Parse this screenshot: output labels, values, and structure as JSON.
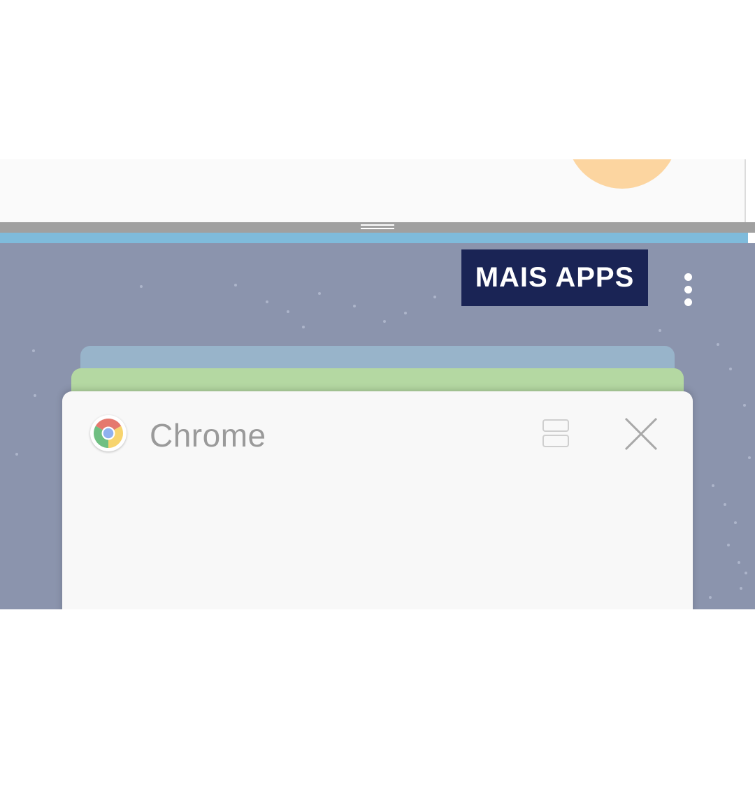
{
  "recents": {
    "more_apps_label": "MAIS APPS",
    "more_options_icon": "more-vert-icon"
  },
  "app_card": {
    "title": "Chrome",
    "app_icon": "chrome-icon",
    "split_screen_icon": "split-screen-icon",
    "close_icon": "close-icon"
  },
  "colors": {
    "recents_background": "#8b94ad",
    "more_apps_background": "#1a2455",
    "card_background": "#f8f8f8",
    "back_card_blue": "#98b4ca",
    "back_card_green": "#b4d8a2",
    "divider": "#a0a0a0",
    "accent_strip": "#7fbbdb"
  }
}
